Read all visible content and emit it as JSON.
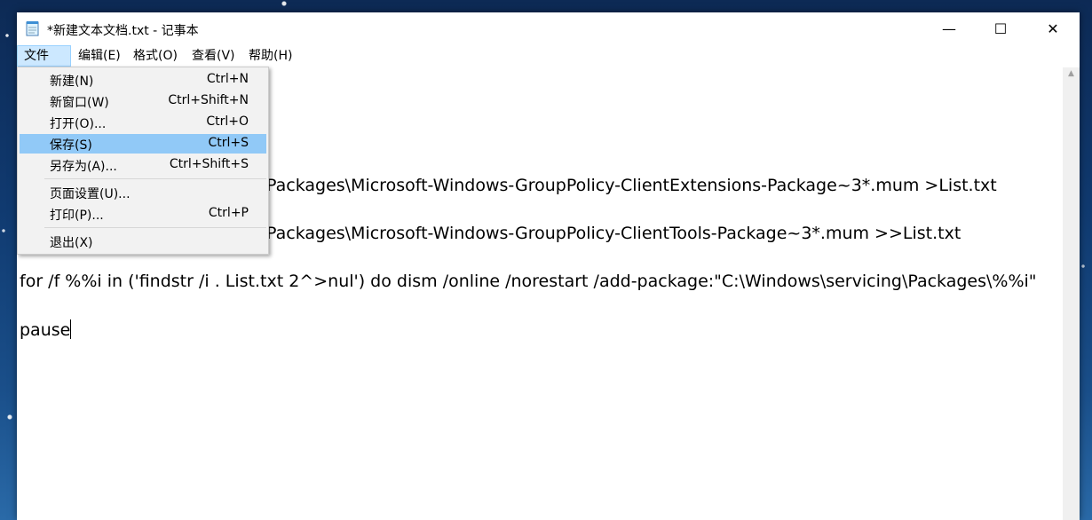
{
  "window": {
    "title": "*新建文本文档.txt - 记事本",
    "minimize_glyph": "—",
    "maximize_glyph": "☐",
    "close_glyph": "✕"
  },
  "menubar": {
    "items": [
      {
        "label": "文件(F)"
      },
      {
        "label": "编辑(E)"
      },
      {
        "label": "格式(O)"
      },
      {
        "label": "查看(V)"
      },
      {
        "label": "帮助(H)"
      }
    ]
  },
  "file_menu": {
    "items": [
      {
        "label": "新建(N)",
        "shortcut": "Ctrl+N"
      },
      {
        "label": "新窗口(W)",
        "shortcut": "Ctrl+Shift+N"
      },
      {
        "label": "打开(O)...",
        "shortcut": "Ctrl+O"
      },
      {
        "label": "保存(S)",
        "shortcut": "Ctrl+S"
      },
      {
        "label": "另存为(A)...",
        "shortcut": "Ctrl+Shift+S"
      },
      {
        "label": "页面设置(U)...",
        "shortcut": ""
      },
      {
        "label": "打印(P)...",
        "shortcut": "Ctrl+P"
      },
      {
        "label": "退出(X)",
        "shortcut": ""
      }
    ]
  },
  "editor": {
    "lines": [
      "Packages\\Microsoft-Windows-GroupPolicy-ClientExtensions-Package~3*.mum >List.txt",
      "Packages\\Microsoft-Windows-GroupPolicy-ClientTools-Package~3*.mum >>List.txt",
      "for /f %%i in ('findstr /i . List.txt 2^>nul') do dism /online /norestart /add-package:\"C:\\Windows\\servicing\\Packages\\%%i\"",
      "pause"
    ]
  },
  "colors": {
    "menu_highlight": "#91c9f7",
    "menu_active": "#cce8ff"
  },
  "icons": {
    "app": "notepad-icon",
    "scroll_up": "scroll-up-arrow-icon"
  }
}
